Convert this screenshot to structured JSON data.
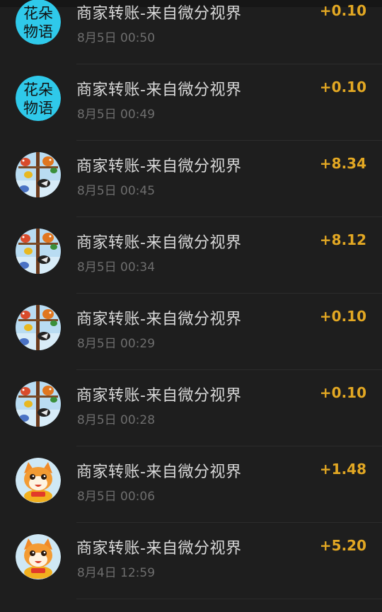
{
  "transactions": [
    {
      "title": "商家转账-来自微分视界",
      "time": "8月5日 00:50",
      "amount": "+0.10",
      "avatar_icon": "flower-text-avatar-icon",
      "avatar_text": [
        "花朵",
        "物语"
      ]
    },
    {
      "title": "商家转账-来自微分视界",
      "time": "8月5日 00:49",
      "amount": "+0.10",
      "avatar_icon": "flower-text-avatar-icon",
      "avatar_text": [
        "花朵",
        "物语"
      ]
    },
    {
      "title": "商家转账-来自微分视界",
      "time": "8月5日 00:45",
      "amount": "+8.34",
      "avatar_icon": "birds-avatar-icon"
    },
    {
      "title": "商家转账-来自微分视界",
      "time": "8月5日 00:34",
      "amount": "+8.12",
      "avatar_icon": "birds-avatar-icon"
    },
    {
      "title": "商家转账-来自微分视界",
      "time": "8月5日 00:29",
      "amount": "+0.10",
      "avatar_icon": "birds-avatar-icon"
    },
    {
      "title": "商家转账-来自微分视界",
      "time": "8月5日 00:28",
      "amount": "+0.10",
      "avatar_icon": "birds-avatar-icon"
    },
    {
      "title": "商家转账-来自微分视界",
      "time": "8月5日 00:06",
      "amount": "+1.48",
      "avatar_icon": "cat-avatar-icon"
    },
    {
      "title": "商家转账-来自微分视界",
      "time": "8月4日 12:59",
      "amount": "+5.20",
      "avatar_icon": "cat-avatar-icon"
    }
  ],
  "colors": {
    "background": "#1e1e1e",
    "amount": "#e3a823",
    "title": "#d8d8d8",
    "time": "#6e6e6e",
    "flower_avatar_bg": "#2fc9ea"
  }
}
